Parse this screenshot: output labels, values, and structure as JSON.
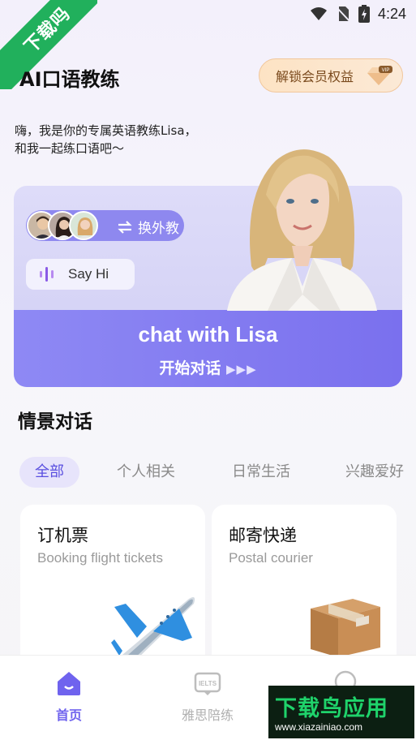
{
  "status": {
    "time": "4:24",
    "badge": "下载吗"
  },
  "header": {
    "title": "AI口语教练",
    "vip_label": "解锁会员权益",
    "vip_tag": "VIP"
  },
  "greeting": {
    "line1": "嗨，我是你的专属英语教练Lisa，",
    "line2": "和我一起练口语吧～"
  },
  "hero": {
    "switch_label": "换外教",
    "sayhi_label": "Say Hi",
    "title": "chat with Lisa",
    "subtitle": "开始对话",
    "arrows": "▶▶▶"
  },
  "scenes": {
    "title": "情景对话",
    "tabs": [
      "全部",
      "个人相关",
      "日常生活",
      "兴趣爱好"
    ],
    "active_tab": 0,
    "cards": [
      {
        "title": "订机票",
        "subtitle": "Booking flight tickets",
        "icon": "airplane-icon"
      },
      {
        "title": "邮寄快递",
        "subtitle": "Postal courier",
        "icon": "package-icon"
      }
    ]
  },
  "tabbar": {
    "items": [
      {
        "label": "首页",
        "icon": "home-icon",
        "active": true
      },
      {
        "label": "雅思陪练",
        "icon": "ielts-icon",
        "active": false
      },
      {
        "label": "",
        "icon": "profile-icon",
        "active": false
      }
    ]
  },
  "watermark": {
    "main": "下载鸟应用",
    "url": "www.xiazainiao.com"
  },
  "colors": {
    "accent": "#6f63ee",
    "vip": "#f1c79c",
    "badge": "#21b05c"
  }
}
